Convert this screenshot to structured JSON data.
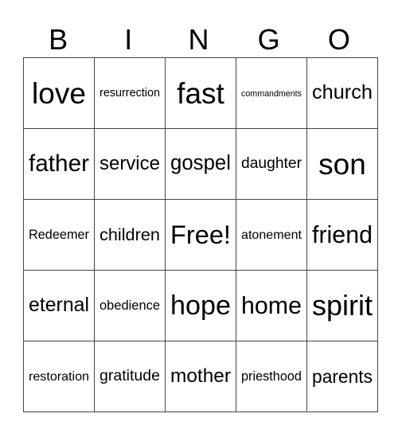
{
  "header": {
    "letters": [
      "B",
      "I",
      "N",
      "G",
      "O"
    ]
  },
  "board": {
    "rows": [
      [
        {
          "text": "love",
          "size": 35
        },
        {
          "text": "resurrection",
          "size": 14.8
        },
        {
          "text": "fast",
          "size": 36
        },
        {
          "text": "commandments",
          "size": 10.3
        },
        {
          "text": "church",
          "size": 25
        }
      ],
      [
        {
          "text": "father",
          "size": 29
        },
        {
          "text": "service",
          "size": 23.3
        },
        {
          "text": "gospel",
          "size": 25.7
        },
        {
          "text": "daughter",
          "size": 19.2
        },
        {
          "text": "son",
          "size": 36
        }
      ],
      [
        {
          "text": "Redeemer",
          "size": 15.6
        },
        {
          "text": "children",
          "size": 21
        },
        {
          "text": "Free!",
          "size": 32
        },
        {
          "text": "atonement",
          "size": 15.9
        },
        {
          "text": "friend",
          "size": 30.5
        }
      ],
      [
        {
          "text": "eternal",
          "size": 24.8
        },
        {
          "text": "obedience",
          "size": 16.4
        },
        {
          "text": "hope",
          "size": 33.6
        },
        {
          "text": "home",
          "size": 29.6
        },
        {
          "text": "spirit",
          "size": 35.4
        }
      ],
      [
        {
          "text": "restoration",
          "size": 15.9
        },
        {
          "text": "gratitude",
          "size": 19
        },
        {
          "text": "mother",
          "size": 24.4
        },
        {
          "text": "priesthood",
          "size": 15.8
        },
        {
          "text": "parents",
          "size": 22.5
        }
      ]
    ],
    "free_space": "Free!"
  }
}
